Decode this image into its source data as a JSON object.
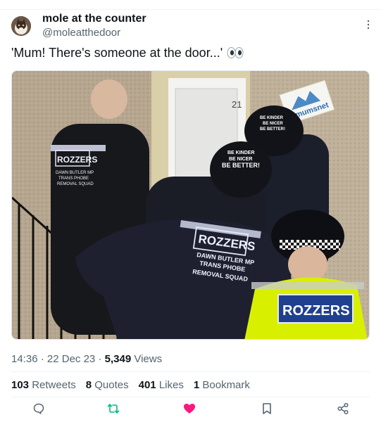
{
  "author": {
    "name": "mole at the counter",
    "handle": "@moleatthedoor"
  },
  "tweet": {
    "text": "'Mum! There's someone at the door...'",
    "emoji_icon": "eyes-emoji"
  },
  "media": {
    "jacket_text_main": "ROZZERS",
    "jacket_subtext": [
      "DAWN BUTLER MP",
      "TRANS PHOBE",
      "REMOVAL SQUAD"
    ],
    "helmet_text": [
      "BE KINDER",
      "BE NICER",
      "BE BETTER!"
    ],
    "vest_text": "ROZZERS",
    "door_number": "21",
    "sign_text": "mumsnet"
  },
  "meta": {
    "time": "14:36",
    "date": "22 Dec 23",
    "views_count": "5,349",
    "views_label": "Views"
  },
  "stats": {
    "retweets_count": "103",
    "retweets_label": "Retweets",
    "quotes_count": "8",
    "quotes_label": "Quotes",
    "likes_count": "401",
    "likes_label": "Likes",
    "bookmarks_count": "1",
    "bookmarks_label": "Bookmark"
  },
  "colors": {
    "text": "#0f1419",
    "secondary": "#536471",
    "retweet": "#00ba7c",
    "like": "#f91880",
    "vest": "#d8f000"
  }
}
